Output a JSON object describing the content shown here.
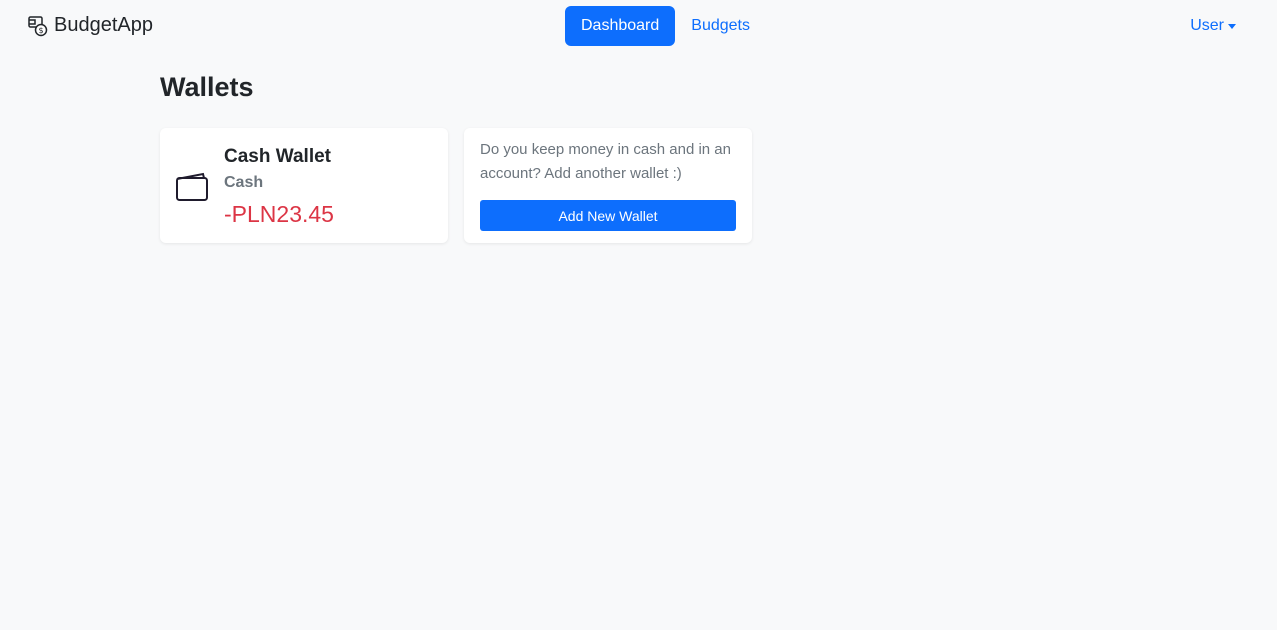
{
  "navbar": {
    "brand_icon": "money-wallet-icon",
    "brand_name": "BudgetApp",
    "links": [
      {
        "label": "Dashboard",
        "active": true
      },
      {
        "label": "Budgets",
        "active": false
      }
    ],
    "user_menu_label": "User"
  },
  "page": {
    "title": "Wallets"
  },
  "wallets": [
    {
      "icon": "wallet-icon",
      "name": "Cash Wallet",
      "type": "Cash",
      "balance": "-PLN23.45"
    }
  ],
  "add_wallet_card": {
    "text": "Do you keep money in cash and in an account? Add another wallet :)",
    "button_label": "Add New Wallet"
  },
  "colors": {
    "primary": "#0d6efd",
    "negative_balance": "#dc3545",
    "background": "#f8f9fa",
    "muted_text": "#6c757d"
  }
}
